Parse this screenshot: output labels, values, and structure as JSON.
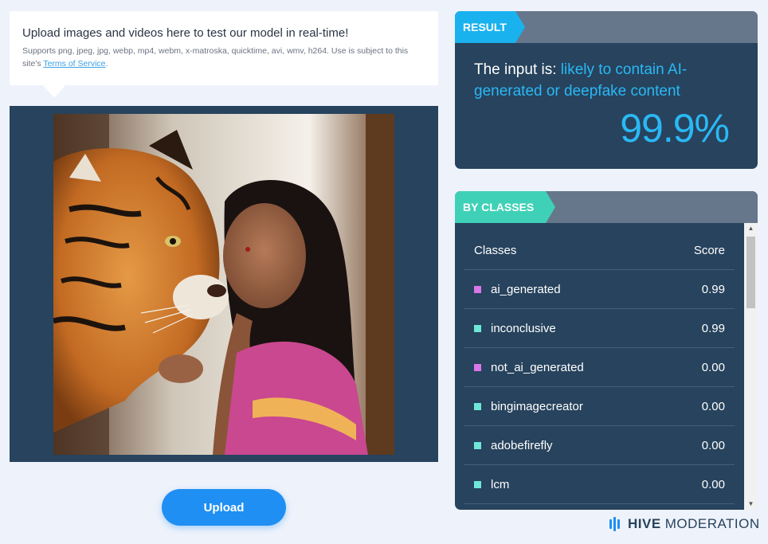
{
  "upload_info": {
    "title": "Upload images and videos here to test our model in real-time!",
    "supports": "Supports png, jpeg, jpg, webp, mp4, webm, x-matroska, quicktime, avi, wmv, h264. Use is subject to this site's ",
    "tos_link": "Terms of Service",
    "period": "."
  },
  "upload_button": "Upload",
  "result": {
    "tag": "RESULT",
    "prefix": "The input is: ",
    "verdict": "likely to contain AI-generated or deepfake content",
    "score": "99.9%"
  },
  "classes": {
    "tag": "BY CLASSES",
    "col_class": "Classes",
    "col_score": "Score",
    "rows": [
      {
        "name": "ai_generated",
        "score": "0.99",
        "color": "#d877e8"
      },
      {
        "name": "inconclusive",
        "score": "0.99",
        "color": "#6ee6d8"
      },
      {
        "name": "not_ai_generated",
        "score": "0.00",
        "color": "#d877e8"
      },
      {
        "name": "bingimagecreator",
        "score": "0.00",
        "color": "#6ee6d8"
      },
      {
        "name": "adobefirefly",
        "score": "0.00",
        "color": "#6ee6d8"
      },
      {
        "name": "lcm",
        "score": "0.00",
        "color": "#6ee6d8"
      }
    ]
  },
  "brand": {
    "hive": "HIVE",
    "moderation": "MODERATION"
  },
  "colors": {
    "accent_blue": "#2ab8f5",
    "accent_teal": "#3fd1b7",
    "panel": "#27435d"
  }
}
